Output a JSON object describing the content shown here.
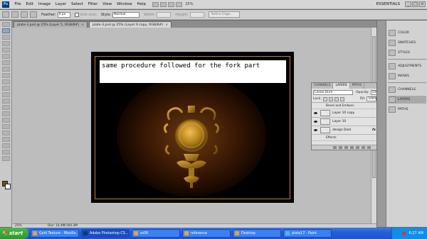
{
  "menubar": {
    "logo": "Ps",
    "items": [
      "File",
      "Edit",
      "Image",
      "Layer",
      "Select",
      "Filter",
      "View",
      "Window",
      "Help"
    ],
    "zoom": "25%",
    "workspace": "ESSENTIALS"
  },
  "window_controls": [
    "_",
    "□",
    "×"
  ],
  "options": {
    "feather_label": "Feather:",
    "feather_value": "0 px",
    "antialias_label": "Anti-alias",
    "style_label": "Style:",
    "style_value": "Normal",
    "width_label": "Width:",
    "height_label": "Height:",
    "refine_edge": "Refine Edge..."
  },
  "tabs": [
    {
      "label": "plate-3.psd @ 25% (Layer 5, RGB/8#)",
      "active": false
    },
    {
      "label": "plate-3.psd @ 25% (Layer 9 copy, RGB/8#)",
      "active": true
    }
  ],
  "tab_close": "×",
  "canvas": {
    "caption": "same procedure followed for the fork part"
  },
  "status": {
    "zoom": "25%",
    "doc": "Doc: 14.4M/164.3M"
  },
  "layers_panel": {
    "tabs": [
      "CHANNELS",
      "LAYERS",
      "PATHS"
    ],
    "active_tab": "LAYERS",
    "blend_mode": "Linear Burn",
    "opacity_label": "Opacity:",
    "opacity_value": "100%",
    "lock_label": "Lock:",
    "fill_label": "Fill:",
    "fill_value": "100%",
    "effect_top": "Bevel and Emboss",
    "layers": [
      {
        "name": "Layer 10 copy",
        "fx": ""
      },
      {
        "name": "Layer 10",
        "fx": ""
      },
      {
        "name": "design Dark",
        "fx": "fx"
      }
    ],
    "effect_bottom": "Effects"
  },
  "dock": {
    "items": [
      "COLOR",
      "SWATCHES",
      "STYLES",
      "ADJUSTMENTS",
      "MASKS",
      "CHANNELS",
      "LAYERS",
      "PATHS"
    ],
    "active": "LAYERS"
  },
  "taskbar": {
    "start_label": "start",
    "tasks": [
      {
        "label": "Gold Texture - Mozilla...",
        "active": false
      },
      {
        "label": "Adobe Photoshop CS...",
        "active": true
      },
      {
        "label": "ss58",
        "active": false
      },
      {
        "label": "reference",
        "active": false
      },
      {
        "label": "Desktop",
        "active": false
      },
      {
        "label": "plate17 - Paint",
        "active": false
      }
    ],
    "clock": "6:27 AM"
  },
  "colors": {
    "foreground": "#7a4a0c",
    "background": "#ffffff",
    "frame_gold": "#b8862d",
    "xp_blue": "#245edb",
    "start_green": "#3a9c3a"
  }
}
